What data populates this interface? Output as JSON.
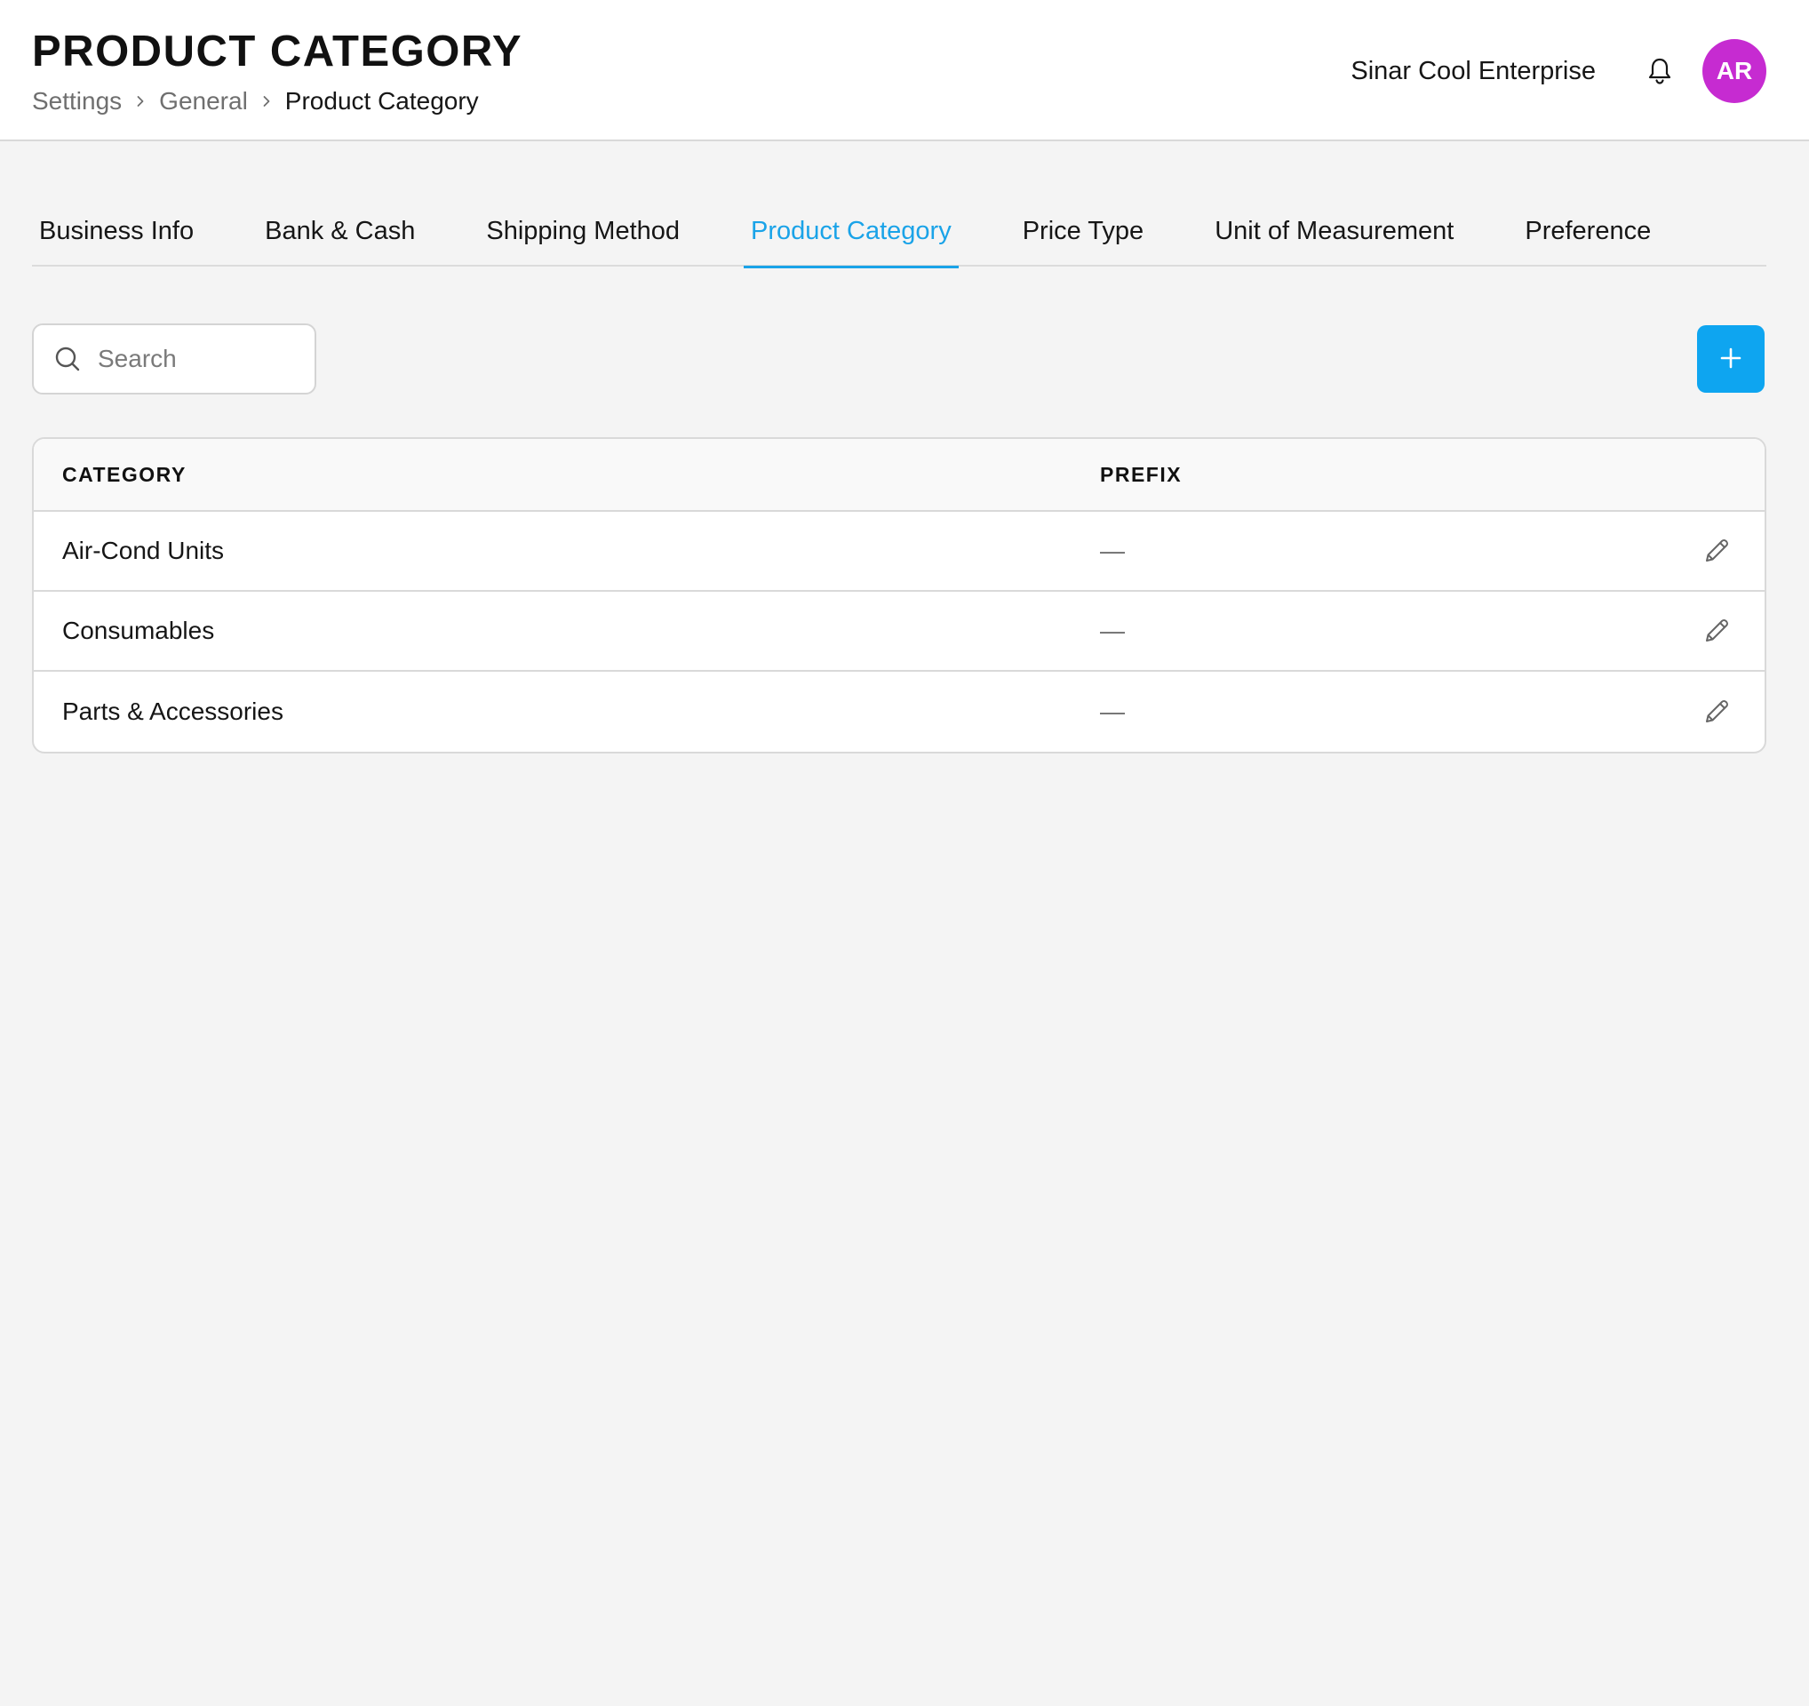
{
  "header": {
    "title": "PRODUCT CATEGORY",
    "breadcrumb": [
      "Settings",
      "General",
      "Product Category"
    ],
    "company_name": "Sinar Cool Enterprise",
    "avatar_initials": "AR",
    "avatar_color": "#c62bd1",
    "notification_icon": "bell-icon"
  },
  "tabs": [
    {
      "label": "Business Info",
      "active": false
    },
    {
      "label": "Bank & Cash",
      "active": false
    },
    {
      "label": "Shipping Method",
      "active": false
    },
    {
      "label": "Product Category",
      "active": true
    },
    {
      "label": "Price Type",
      "active": false
    },
    {
      "label": "Unit of Measurement",
      "active": false
    },
    {
      "label": "Preference",
      "active": false
    }
  ],
  "toolbar": {
    "search_placeholder": "Search",
    "search_value": "",
    "add_icon": "plus-icon",
    "accent_color": "#0ea5f0"
  },
  "table": {
    "headers": {
      "category": "CATEGORY",
      "prefix": "PREFIX"
    },
    "rows": [
      {
        "category": "Air-Cond Units",
        "prefix": "—"
      },
      {
        "category": "Consumables",
        "prefix": "—"
      },
      {
        "category": "Parts & Accessories",
        "prefix": "—"
      }
    ],
    "row_action_icon": "pencil-icon"
  }
}
